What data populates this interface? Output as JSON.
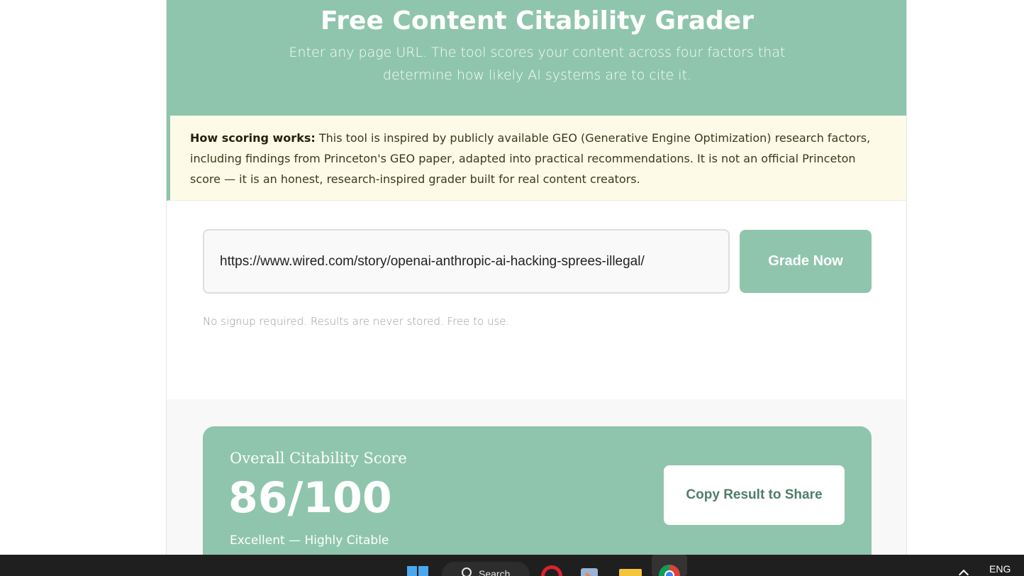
{
  "hero": {
    "title": "Free Content Citability Grader",
    "subtitle": "Enter any page URL. The tool scores your content across four factors that determine how likely AI systems are to cite it."
  },
  "note": {
    "label": "How scoring works:",
    "text": " This tool is inspired by publicly available GEO (Generative Engine Optimization) research factors, including findings from Princeton's GEO paper, adapted into practical recommendations. It is not an official Princeton score — it is an honest, research-inspired grader built for real content creators."
  },
  "form": {
    "url_value": "https://www.wired.com/story/openai-anthropic-ai-hacking-sprees-illegal/",
    "button_label": "Grade Now",
    "hint": "No signup required. Results are never stored. Free to use."
  },
  "result": {
    "label": "Overall Citability Score",
    "score": "86/100",
    "description": "Excellent — Highly Citable",
    "copy_label": "Copy Result to Share"
  },
  "taskbar": {
    "search_label": "Search",
    "language": "ENG",
    "icons": [
      "windows-start-icon",
      "search-icon",
      "opera-icon",
      "media-player-icon",
      "file-explorer-icon",
      "chrome-icon",
      "tray-chevron-icon"
    ]
  },
  "colors": {
    "accent": "#8fc5ad",
    "note_bg": "#fdfbe8",
    "copy_text": "#4f7e69"
  }
}
